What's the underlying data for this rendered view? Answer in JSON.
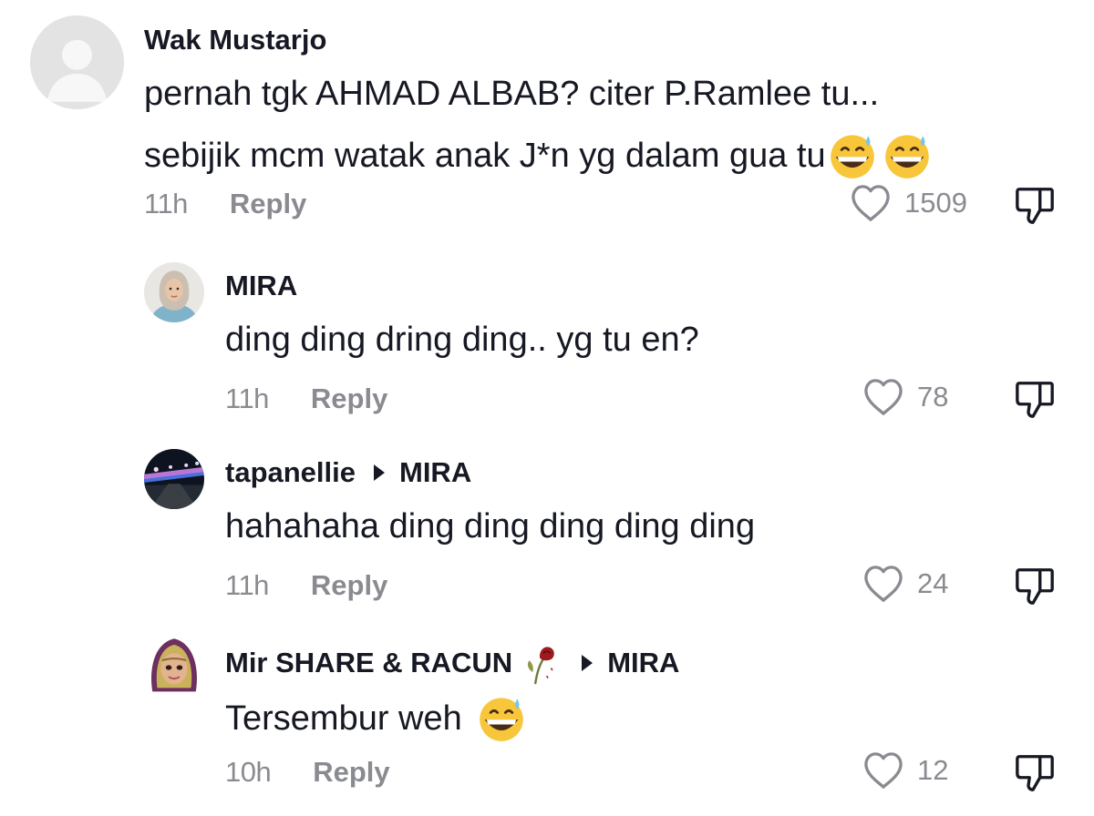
{
  "comments": [
    {
      "username": "Wak Mustarjo",
      "lines": [
        "pernah tgk AHMAD ALBAB? citer P.Ramlee tu...",
        "sebijik mcm watak anak J*n yg dalam gua tu"
      ],
      "time": "11h",
      "reply_label": "Reply",
      "likes": "1509",
      "avatar_icon": "default-avatar-icon"
    },
    {
      "username": "MIRA",
      "lines": [
        "ding ding dring ding.. yg tu en?"
      ],
      "time": "11h",
      "reply_label": "Reply",
      "likes": "78",
      "avatar_icon": "user-photo-avatar"
    },
    {
      "username": "tapanellie",
      "reply_to": "MIRA",
      "lines": [
        "hahahaha ding ding ding ding ding"
      ],
      "time": "11h",
      "reply_label": "Reply",
      "likes": "24",
      "avatar_icon": "city-night-avatar"
    },
    {
      "username": "Mir SHARE & RACUN",
      "reply_to": "MIRA",
      "lines": [
        "Tersembur weh"
      ],
      "time": "10h",
      "reply_label": "Reply",
      "likes": "12",
      "avatar_icon": "hijab-avatar"
    }
  ],
  "icons": {
    "like": "heart-outline-icon",
    "dislike": "thumbs-down-icon",
    "emoji": "grinning-sweat-emoji",
    "rose": "wilted-rose-emoji",
    "arrow": "reply-arrow-icon"
  },
  "colors": {
    "text": "#161823",
    "secondary": "#8a8b91",
    "background": "#ffffff"
  }
}
